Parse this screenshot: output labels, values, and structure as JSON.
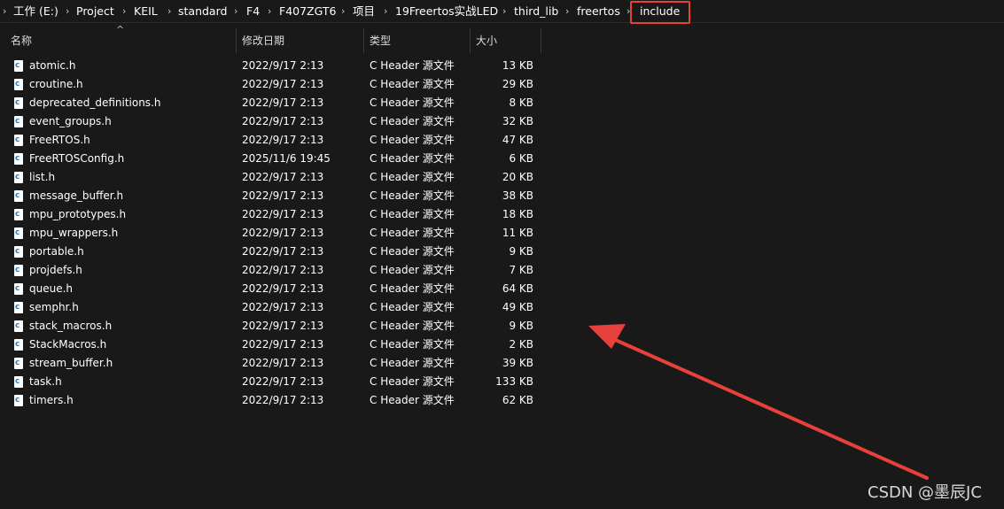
{
  "breadcrumb": {
    "parts": [
      "工作 (E:)",
      "Project",
      "KEIL",
      "standard",
      "F4",
      "F407ZGT6",
      "项目",
      "19Freertos实战LED",
      "third_lib",
      "freertos",
      "include"
    ],
    "separator": "›"
  },
  "columns": {
    "name": "名称",
    "date": "修改日期",
    "type": "类型",
    "size": "大小"
  },
  "files": [
    {
      "name": "atomic.h",
      "date": "2022/9/17 2:13",
      "type": "C Header 源文件",
      "size": "13 KB"
    },
    {
      "name": "croutine.h",
      "date": "2022/9/17 2:13",
      "type": "C Header 源文件",
      "size": "29 KB"
    },
    {
      "name": "deprecated_definitions.h",
      "date": "2022/9/17 2:13",
      "type": "C Header 源文件",
      "size": "8 KB"
    },
    {
      "name": "event_groups.h",
      "date": "2022/9/17 2:13",
      "type": "C Header 源文件",
      "size": "32 KB"
    },
    {
      "name": "FreeRTOS.h",
      "date": "2022/9/17 2:13",
      "type": "C Header 源文件",
      "size": "47 KB"
    },
    {
      "name": "FreeRTOSConfig.h",
      "date": "2025/11/6 19:45",
      "type": "C Header 源文件",
      "size": "6 KB"
    },
    {
      "name": "list.h",
      "date": "2022/9/17 2:13",
      "type": "C Header 源文件",
      "size": "20 KB"
    },
    {
      "name": "message_buffer.h",
      "date": "2022/9/17 2:13",
      "type": "C Header 源文件",
      "size": "38 KB"
    },
    {
      "name": "mpu_prototypes.h",
      "date": "2022/9/17 2:13",
      "type": "C Header 源文件",
      "size": "18 KB"
    },
    {
      "name": "mpu_wrappers.h",
      "date": "2022/9/17 2:13",
      "type": "C Header 源文件",
      "size": "11 KB"
    },
    {
      "name": "portable.h",
      "date": "2022/9/17 2:13",
      "type": "C Header 源文件",
      "size": "9 KB"
    },
    {
      "name": "projdefs.h",
      "date": "2022/9/17 2:13",
      "type": "C Header 源文件",
      "size": "7 KB"
    },
    {
      "name": "queue.h",
      "date": "2022/9/17 2:13",
      "type": "C Header 源文件",
      "size": "64 KB"
    },
    {
      "name": "semphr.h",
      "date": "2022/9/17 2:13",
      "type": "C Header 源文件",
      "size": "49 KB"
    },
    {
      "name": "stack_macros.h",
      "date": "2022/9/17 2:13",
      "type": "C Header 源文件",
      "size": "9 KB"
    },
    {
      "name": "StackMacros.h",
      "date": "2022/9/17 2:13",
      "type": "C Header 源文件",
      "size": "2 KB"
    },
    {
      "name": "stream_buffer.h",
      "date": "2022/9/17 2:13",
      "type": "C Header 源文件",
      "size": "39 KB"
    },
    {
      "name": "task.h",
      "date": "2022/9/17 2:13",
      "type": "C Header 源文件",
      "size": "133 KB"
    },
    {
      "name": "timers.h",
      "date": "2022/9/17 2:13",
      "type": "C Header 源文件",
      "size": "62 KB"
    }
  ],
  "file_icon": {
    "name": "c-header-file-icon",
    "letter": "c"
  },
  "annotation": {
    "arrow_color": "#e8413c",
    "highlight_color": "#e8413c"
  },
  "watermark": "CSDN @墨辰JC"
}
